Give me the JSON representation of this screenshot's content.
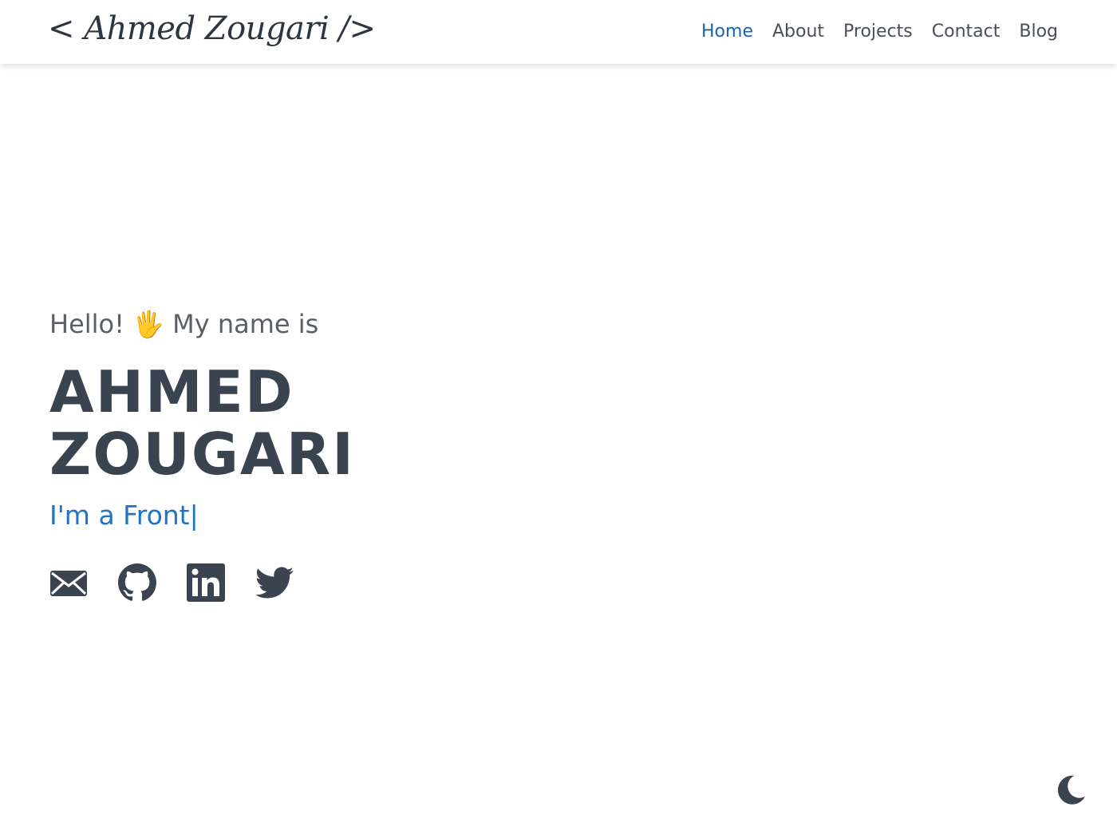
{
  "header": {
    "logo": "< Ahmed Zougari />",
    "nav": [
      {
        "label": "Home",
        "active": true
      },
      {
        "label": "About",
        "active": false
      },
      {
        "label": "Projects",
        "active": false
      },
      {
        "label": "Contact",
        "active": false
      },
      {
        "label": "Blog",
        "active": false
      }
    ]
  },
  "hero": {
    "greeting": "Hello! 🖐 My name is",
    "name_line1": "AHMED",
    "name_line2": "ZOUGARI",
    "typed_text": "I'm a Front",
    "cursor": "|",
    "socials": [
      {
        "icon": "envelope-icon"
      },
      {
        "icon": "github-icon"
      },
      {
        "icon": "linkedin-icon"
      },
      {
        "icon": "twitter-icon"
      }
    ]
  },
  "theme_toggle": {
    "icon": "moon-icon"
  },
  "colors": {
    "accent": "#1f74c4",
    "nav_active": "#1565a8",
    "text": "#4a4f57",
    "icon": "#3a4350",
    "background": "#ffffff"
  }
}
